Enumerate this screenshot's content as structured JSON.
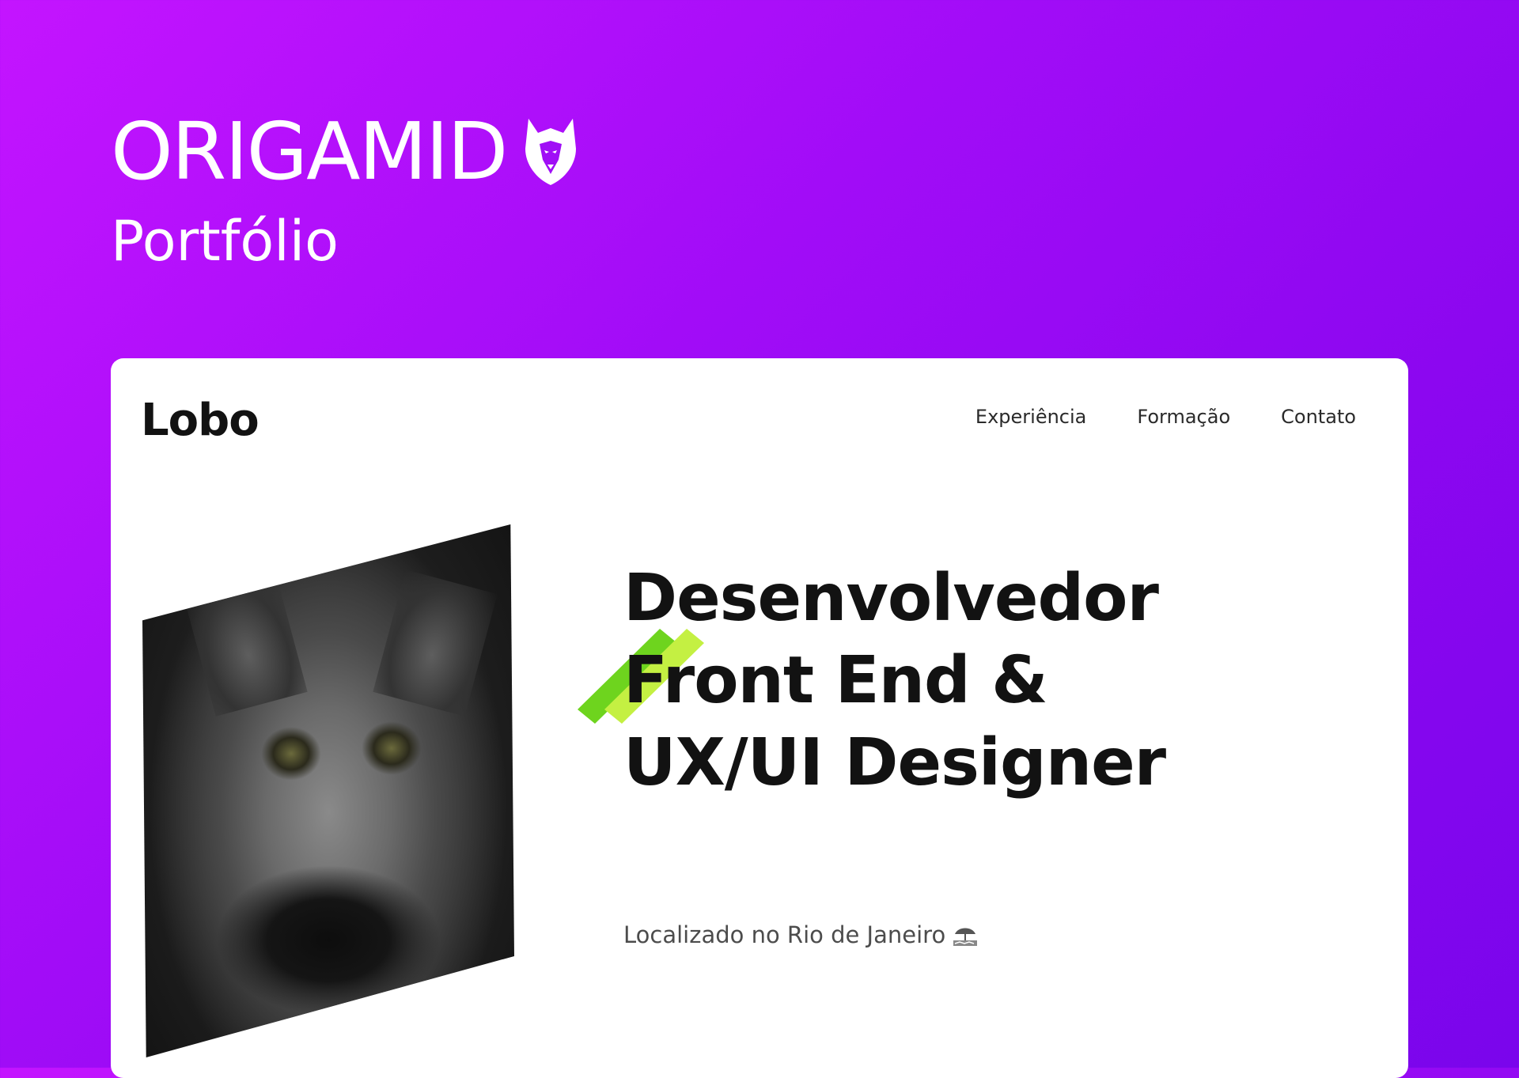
{
  "brand": {
    "name": "ORIGAMID",
    "subtitle": "Portfólio",
    "color": "#ffffff",
    "logo_icon": "wolf-head-icon"
  },
  "background": {
    "gradient_start": "#c414ff",
    "gradient_end": "#7a05ec"
  },
  "site": {
    "name": "Lobo",
    "nav": [
      {
        "label": "Experiência"
      },
      {
        "label": "Formação"
      },
      {
        "label": "Contato"
      }
    ],
    "hero": {
      "headline": [
        "Desenvolvedor",
        "Front End &",
        "UX/UI Designer"
      ],
      "location": "Localizado no Rio de Janeiro",
      "location_icon": "beach-umbrella-icon",
      "image": "wolf-photo",
      "accent_colors": [
        "#6ed41e",
        "#c4f042"
      ]
    }
  }
}
